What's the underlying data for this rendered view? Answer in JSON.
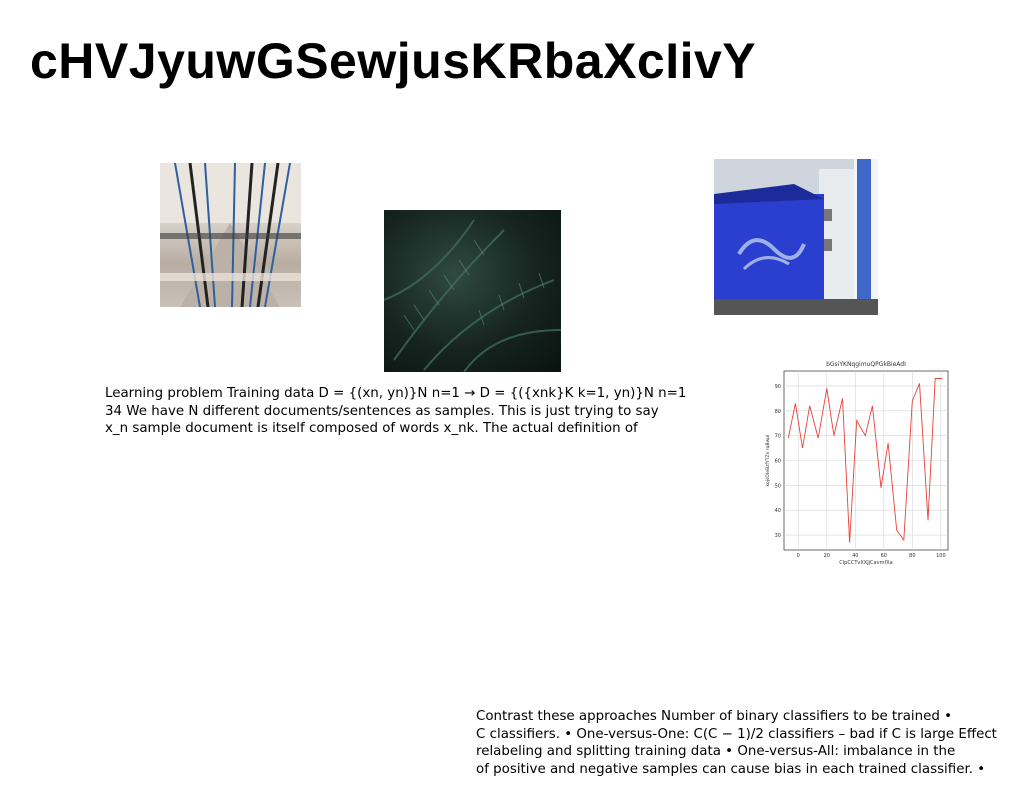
{
  "title": "cHVJyuwGSewjusKRbaXcIivY",
  "paragraph1_lines": [
    "Learning problem Training data D = {(xn, yn)}N n=1 → D = {({xnk}K k=1, yn)}N n=1",
    "34 We have N different documents/sentences as samples. This is just trying to say",
    "x_n sample document is itself composed of words x_nk. The actual definition of"
  ],
  "paragraph2_lines": [
    "Contrast these approaches Number of binary classifiers to be trained •",
    "C classifiers. • One-versus-One: C(C − 1)/2 classifiers – bad if C is large Effect",
    "relabeling and splitting training data • One-versus-All: imbalance in the",
    "of positive and negative samples can cause bias in each trained classifier. •"
  ],
  "chart_data": {
    "type": "line",
    "title": "bGsiYKNqgimuQPGkBieAdI",
    "xlabel": "ClpCCTvXXJjCavmfXa",
    "ylabel": "kojsOIeBzfYTZn rqBwpI",
    "xlim": [
      -10,
      105
    ],
    "ylim": [
      24,
      96
    ],
    "xticks": [
      0,
      20,
      40,
      60,
      80,
      100
    ],
    "yticks": [
      30,
      40,
      50,
      60,
      70,
      80,
      90
    ],
    "grid": true,
    "line_color": "#e8413a",
    "x": [
      -7,
      -2,
      3,
      8,
      14,
      20,
      25,
      31,
      36,
      41,
      47,
      52,
      58,
      63,
      69,
      74,
      80,
      85,
      91,
      96,
      101
    ],
    "y": [
      69,
      83,
      65,
      82,
      69,
      89,
      70,
      85,
      27,
      76,
      70,
      82,
      49,
      67,
      32,
      28,
      84,
      91,
      36,
      93,
      93
    ]
  }
}
